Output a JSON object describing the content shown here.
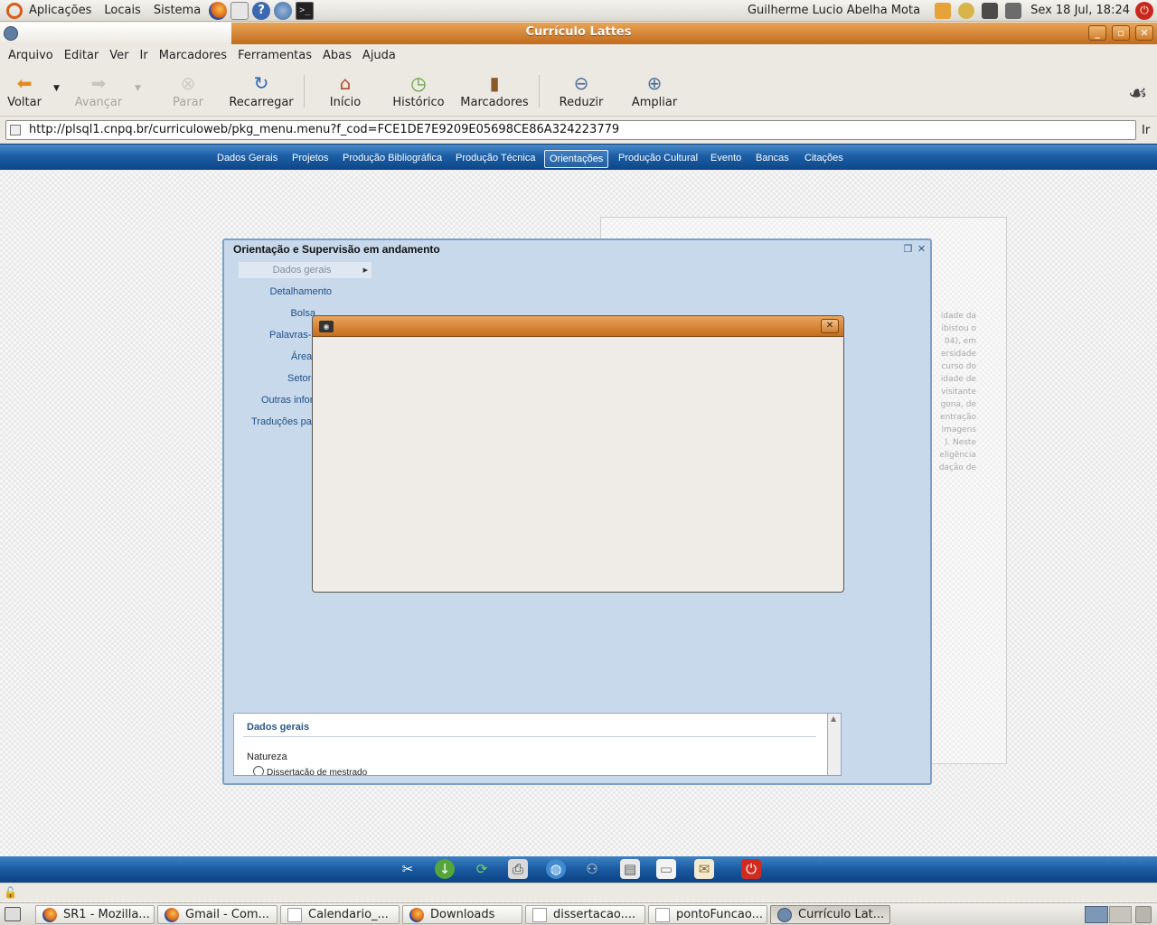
{
  "top_panel": {
    "menus": [
      "Aplicações",
      "Locais",
      "Sistema"
    ],
    "user": "Guilherme Lucio Abelha Mota",
    "clock": "Sex 18 Jul, 18:24"
  },
  "window": {
    "title": "Currículo Lattes"
  },
  "menubar": [
    {
      "label": "Arquivo"
    },
    {
      "label": "Editar"
    },
    {
      "label": "Ver"
    },
    {
      "label": "Ir"
    },
    {
      "label": "Marcadores"
    },
    {
      "label": "Ferramentas"
    },
    {
      "label": "Abas"
    },
    {
      "label": "Ajuda"
    }
  ],
  "toolbar": {
    "back": "Voltar",
    "forward": "Avançar",
    "stop": "Parar",
    "reload": "Recarregar",
    "home": "Início",
    "history": "Histórico",
    "bookmarks": "Marcadores",
    "zoom_out": "Reduzir",
    "zoom_in": "Ampliar"
  },
  "location": {
    "url": "http://plsql1.cnpq.br/curriculoweb/pkg_menu.menu?f_cod=FCE1DE7E9209E05698CE86A324223779",
    "go": "Ir"
  },
  "site_nav": [
    {
      "label": "Dados Gerais"
    },
    {
      "label": "Projetos"
    },
    {
      "label": "Produção Bibliográfica"
    },
    {
      "label": "Produção Técnica"
    },
    {
      "label": "Orientações"
    },
    {
      "label": "Produção Cultural"
    },
    {
      "label": "Evento"
    },
    {
      "label": "Bancas"
    },
    {
      "label": "Citações"
    }
  ],
  "active_tab": "Orientações",
  "background_text": [
    "idade da",
    "ibistou o",
    "04), em",
    "ersidade",
    "curso do",
    "idade de",
    "visitante",
    "gona, de",
    "entração",
    "imagens",
    "). Neste",
    "eligência",
    "dação de"
  ],
  "panel": {
    "title": "Orientação e Supervisão em andamento",
    "side_items": [
      {
        "label": "Dados gerais"
      },
      {
        "label": "Detalhamento"
      },
      {
        "label": "Bolsa"
      },
      {
        "label": "Palavras-"
      },
      {
        "label": "Área"
      },
      {
        "label": "Setore"
      },
      {
        "label": "Outras infor"
      },
      {
        "label": "Traduções pa"
      }
    ],
    "form": {
      "heading": "Dados gerais",
      "label": "Natureza",
      "radio_label": "Dissertação de mestrado"
    }
  },
  "taskbar": [
    {
      "label": "SR1 - Mozilla..."
    },
    {
      "label": "Gmail - Com..."
    },
    {
      "label": "Calendario_..."
    },
    {
      "label": "Downloads"
    },
    {
      "label": "dissertacao...."
    },
    {
      "label": "pontoFuncao..."
    },
    {
      "label": "Currículo Lat..."
    }
  ],
  "colors": {
    "titlebar_orange": "#c26a1c",
    "site_nav_blue": "#1c5ea6",
    "panel_blue": "#c8d9eb"
  }
}
